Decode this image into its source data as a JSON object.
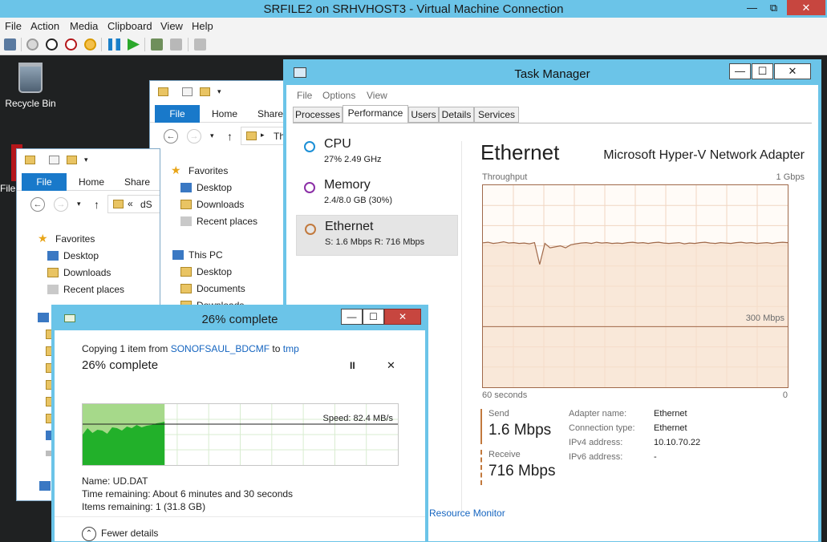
{
  "vm": {
    "title": "SRFILE2 on SRHVHOST3 - Virtual Machine Connection",
    "minimize": "—",
    "restore": "⧉",
    "close": "✕",
    "menu": [
      "File",
      "Action",
      "Media",
      "Clipboard",
      "View",
      "Help"
    ]
  },
  "desktop": {
    "recycle_bin": "Recycle Bin",
    "file_label": "File"
  },
  "explorer_back": {
    "ribbon_file": "File",
    "ribbon_home": "Home",
    "ribbon_share": "Share",
    "address_text": "Th",
    "favorites": "Favorites",
    "desktop": "Desktop",
    "downloads": "Downloads",
    "recent": "Recent places",
    "this_pc": "This PC",
    "pc_desktop": "Desktop",
    "pc_documents": "Documents",
    "pc_downloads": "Downloads"
  },
  "explorer_front": {
    "ribbon_file": "File",
    "ribbon_home": "Home",
    "ribbon_share": "Share",
    "address_text": "dS",
    "address_prefix": "«",
    "favorites": "Favorites",
    "desktop": "Desktop",
    "downloads": "Downloads",
    "recent": "Recent places"
  },
  "task_manager": {
    "title": "Task Manager",
    "minimize": "—",
    "restore": "☐",
    "close": "✕",
    "menu": [
      "File",
      "Options",
      "View"
    ],
    "tabs": [
      "Processes",
      "Performance",
      "Users",
      "Details",
      "Services"
    ],
    "active_tab": "Performance",
    "sidebar": [
      {
        "name": "CPU",
        "sub": "27%  2.49 GHz",
        "color": "#1b8fd6"
      },
      {
        "name": "Memory",
        "sub": "2.4/8.0 GB (30%)",
        "color": "#8b2fa6"
      },
      {
        "name": "Ethernet",
        "sub": "S: 1.6 Mbps  R: 716 Mbps",
        "color": "#c2793d"
      }
    ],
    "heading": "Ethernet",
    "adapter": "Microsoft Hyper-V Network Adapter",
    "throughput_label": "Throughput",
    "max_label": "1 Gbps",
    "mid_label": "300 Mbps",
    "x_left": "60 seconds",
    "x_right": "0",
    "send_label": "Send",
    "send_value": "1.6 Mbps",
    "receive_label": "Receive",
    "receive_value": "716 Mbps",
    "details": [
      {
        "k": "Adapter name:",
        "v": "Ethernet"
      },
      {
        "k": "Connection type:",
        "v": "Ethernet"
      },
      {
        "k": "IPv4 address:",
        "v": "10.10.70.22"
      },
      {
        "k": "IPv6 address:",
        "v": "-"
      }
    ],
    "resource_monitor": "Resource Monitor",
    "accent": "#c2793d",
    "chart_data": {
      "type": "line",
      "ylim": [
        0,
        1000
      ],
      "ylabel": "Mbps",
      "x_range_seconds": [
        60,
        0
      ],
      "series": [
        {
          "values": [
            715,
            718,
            712,
            715,
            720,
            714,
            716,
            712,
            714,
            710,
            716,
            608,
            712,
            690,
            695,
            700,
            690,
            705,
            710,
            714,
            716,
            712,
            718,
            714,
            716,
            712,
            714,
            712,
            716,
            718,
            714,
            716,
            712,
            716,
            718,
            714,
            712,
            714,
            716,
            710,
            714,
            712,
            716,
            718,
            714,
            712,
            716,
            714,
            712,
            716,
            718,
            714,
            716,
            712,
            714,
            716,
            712,
            716,
            718,
            716
          ]
        }
      ]
    }
  },
  "copy_dialog": {
    "title": "26% complete",
    "minimize": "—",
    "restore": "☐",
    "close": "✕",
    "copying_prefix": "Copying 1 item from",
    "source": "SONOFSAUL_BDCMF",
    "to_word": "to",
    "dest": "tmp",
    "progress_text": "26% complete",
    "progress": 0.26,
    "pause": "II",
    "cancel": "✕",
    "speed": "Speed: 82.4 MB/s",
    "name_line": "Name:  UD.DAT",
    "time_line": "Time remaining:  About 6 minutes and 30 seconds",
    "items_line": "Items remaining:  1 (31.8 GB)",
    "fewer_details": "Fewer details"
  }
}
